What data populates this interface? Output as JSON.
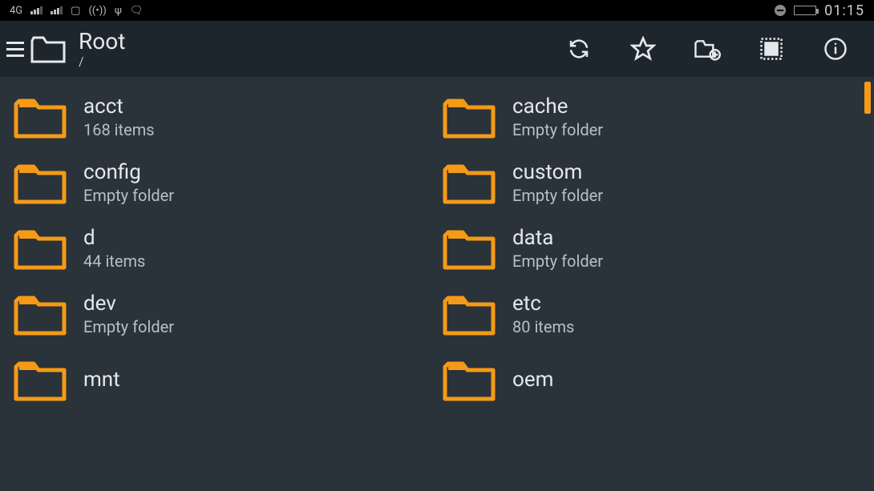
{
  "statusbar": {
    "network_label": "4G",
    "clock": "01:15"
  },
  "toolbar": {
    "title": "Root",
    "path": "/"
  },
  "folders": [
    {
      "name": "acct",
      "subtitle": "168 items"
    },
    {
      "name": "cache",
      "subtitle": "Empty folder"
    },
    {
      "name": "config",
      "subtitle": "Empty folder"
    },
    {
      "name": "custom",
      "subtitle": "Empty folder"
    },
    {
      "name": "d",
      "subtitle": "44 items"
    },
    {
      "name": "data",
      "subtitle": "Empty folder"
    },
    {
      "name": "dev",
      "subtitle": "Empty folder"
    },
    {
      "name": "etc",
      "subtitle": "80 items"
    },
    {
      "name": "mnt",
      "subtitle": ""
    },
    {
      "name": "oem",
      "subtitle": ""
    }
  ],
  "colors": {
    "folder": "#f59a16",
    "bg": "#2a323a",
    "bar": "#1e262d"
  }
}
